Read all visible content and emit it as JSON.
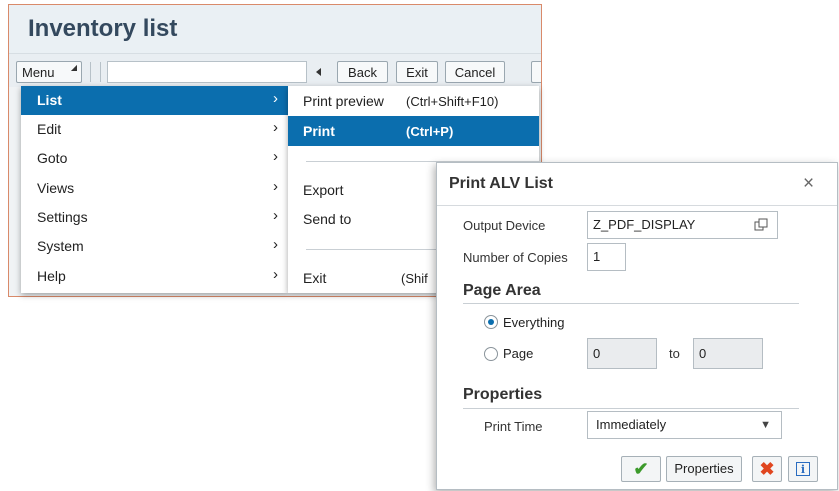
{
  "window": {
    "title": "Inventory list",
    "toolbar": {
      "menu_label": "Menu",
      "back_label": "Back",
      "exit_label": "Exit",
      "cancel_label": "Cancel"
    }
  },
  "menu": {
    "items": [
      {
        "label": "List"
      },
      {
        "label": "Edit"
      },
      {
        "label": "Goto"
      },
      {
        "label": "Views"
      },
      {
        "label": "Settings"
      },
      {
        "label": "System"
      },
      {
        "label": "Help"
      }
    ],
    "active_index": 0
  },
  "submenu": {
    "items": [
      {
        "label": "Print preview",
        "shortcut": "(Ctrl+Shift+F10)"
      },
      {
        "label": "Print",
        "shortcut": "(Ctrl+P)"
      },
      {
        "label": "Export",
        "shortcut": ""
      },
      {
        "label": "Send to",
        "shortcut": ""
      },
      {
        "label": "Exit",
        "shortcut": "(Shif"
      }
    ],
    "active_index": 1
  },
  "dialog": {
    "title": "Print ALV List",
    "close_glyph": "×",
    "output_device_label": "Output Device",
    "output_device_value": "Z_PDF_DISPLAY",
    "copies_label": "Number of Copies",
    "copies_value": "1",
    "page_area_title": "Page Area",
    "everything_label": "Everything",
    "page_label": "Page",
    "page_from": "0",
    "to_label": "to",
    "page_to": "0",
    "selected_page_area": "Everything",
    "properties_title": "Properties",
    "print_time_label": "Print Time",
    "print_time_value": "Immediately",
    "buttons": {
      "ok_glyph": "✔",
      "properties_label": "Properties",
      "cancel_glyph": "✖",
      "info_glyph": "i"
    }
  },
  "colors": {
    "accent": "#0b6eae",
    "ok": "#3c9a2b",
    "cancel": "#e0461f",
    "window_border": "#d98a6a"
  },
  "icons": {
    "copy": "copy-icon",
    "info": "info-icon",
    "close": "close-icon",
    "ok": "checkmark-icon",
    "cancel": "cancel-x-icon"
  }
}
